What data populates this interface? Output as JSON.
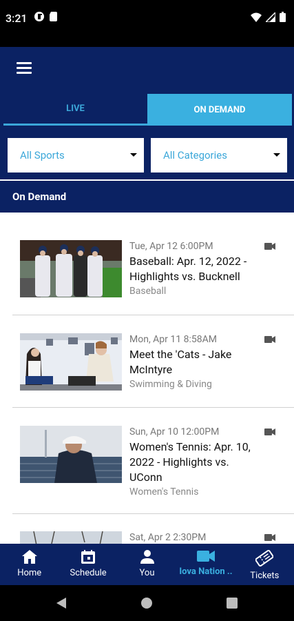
{
  "status_bar": {
    "time": "3:21"
  },
  "tabs": {
    "live": "LIVE",
    "on_demand": "ON DEMAND"
  },
  "filters": {
    "sports": "All Sports",
    "categories": "All Categories"
  },
  "section_title": "On Demand",
  "items": [
    {
      "date": "Tue, Apr 12 6:00PM",
      "title": "Baseball: Apr. 12, 2022 - Highlights vs. Bucknell",
      "sport": "Baseball"
    },
    {
      "date": "Mon, Apr 11 8:58AM",
      "title": "Meet the 'Cats - Jake McIntyre",
      "sport": "Swimming & Diving"
    },
    {
      "date": "Sun, Apr 10 12:00PM",
      "title": "Women's Tennis: Apr. 10, 2022 - Highlights vs. UConn",
      "sport": "Women's Tennis"
    },
    {
      "date": "Sat, Apr 2 2:30PM",
      "title": "",
      "sport": ""
    }
  ],
  "bottom_nav": {
    "home": "Home",
    "schedule": "Schedule",
    "you": "You",
    "nation": "Iova Nation ..",
    "tickets": "Tickets"
  },
  "colors": {
    "navy": "#0b2263",
    "accent": "#3ab0e0"
  }
}
